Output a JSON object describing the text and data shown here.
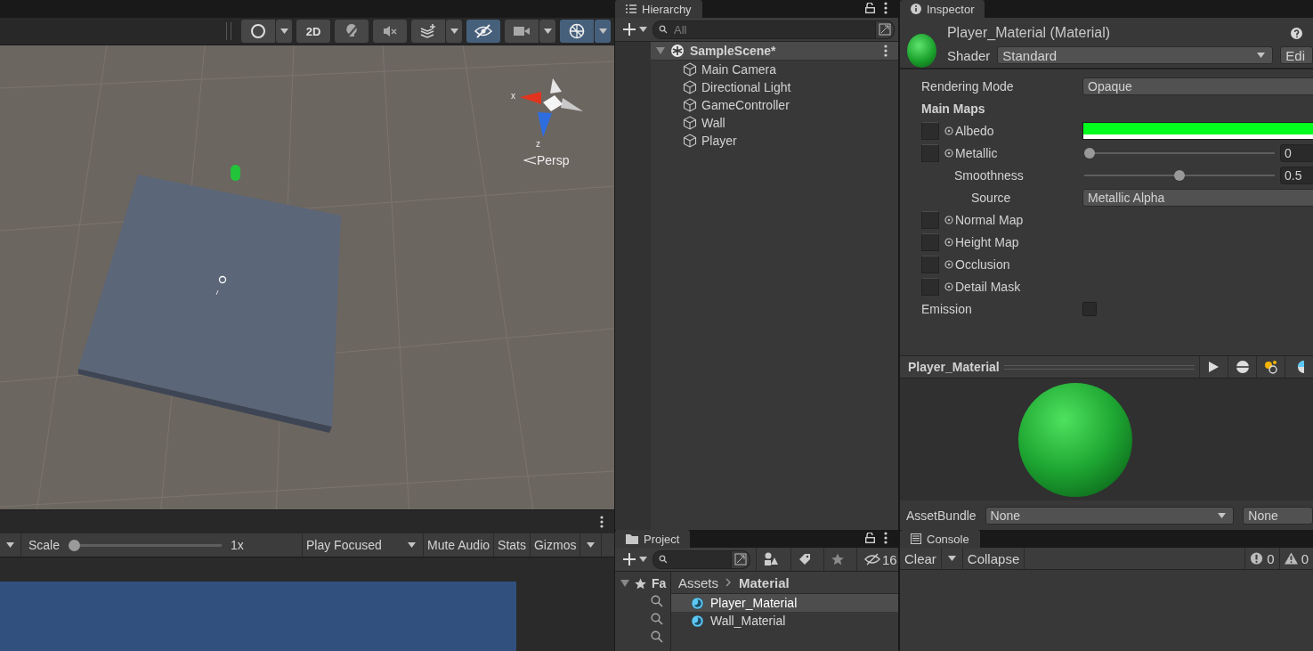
{
  "scene_view": {
    "toolbar": [
      {
        "kind": "shading",
        "selected": false,
        "dropdown": true
      },
      {
        "kind": "mode_2d",
        "label": "2D",
        "selected": false,
        "dropdown": false
      },
      {
        "kind": "lighting",
        "selected": false,
        "dropdown": false
      },
      {
        "kind": "audio",
        "selected": false,
        "dropdown": false
      },
      {
        "kind": "effects",
        "selected": false,
        "dropdown": true
      },
      {
        "kind": "visibility",
        "selected": true,
        "dropdown": false
      },
      {
        "kind": "camera",
        "selected": false,
        "dropdown": true
      },
      {
        "kind": "gizmos",
        "selected": true,
        "dropdown": true
      }
    ],
    "axis_labels": [
      "x",
      "z"
    ],
    "projection": "Persp"
  },
  "game_view": {
    "scale_label": "Scale",
    "scale": {
      "level": 0
    },
    "scale_reading": "1x",
    "play_mode": "Play Focused",
    "toggles": [
      {
        "label": "Mute Audio",
        "selected": false,
        "dropdown": false
      },
      {
        "label": "Stats",
        "selected": false,
        "dropdown": false
      },
      {
        "label": "Gizmos",
        "selected": false,
        "dropdown": true
      }
    ]
  },
  "hierarchy": {
    "tab": "Hierarchy",
    "search": {
      "placeholder": "All"
    },
    "scene": {
      "name": "SampleScene*",
      "expanded": true,
      "children": [
        {
          "name": "Main Camera"
        },
        {
          "name": "Directional Light"
        },
        {
          "name": "GameController"
        },
        {
          "name": "Wall"
        },
        {
          "name": "Player"
        }
      ]
    }
  },
  "project": {
    "tab": "Project",
    "hidden_count": "16",
    "favorites": {
      "label": "Fa",
      "expanded": true,
      "saved_searches": [
        {
          "kind": "search"
        },
        {
          "kind": "search"
        },
        {
          "kind": "search"
        }
      ]
    },
    "breadcrumb": [
      "Assets",
      "Material"
    ],
    "files": [
      {
        "name": "Player_Material",
        "selected": true
      },
      {
        "name": "Wall_Material",
        "selected": false
      }
    ]
  },
  "inspector": {
    "tab": "Inspector",
    "title": "Player_Material (Material)",
    "shader_label": "Shader",
    "shader": "Standard",
    "edit_button": "Edi",
    "properties": [
      {
        "kind": "dropdown",
        "label": "Rendering Mode",
        "value": "Opaque"
      },
      {
        "kind": "header",
        "label": "Main Maps"
      },
      {
        "kind": "color_texture",
        "label": "Albedo",
        "color": "#00ff1e"
      },
      {
        "kind": "slider_texture",
        "label": "Metallic",
        "level": 0,
        "value": "0",
        "children": [
          {
            "kind": "slider",
            "label": "Smoothness",
            "level": 0.5,
            "value": "0.5",
            "children": [
              {
                "kind": "dropdown",
                "label": "Source",
                "value": "Metallic Alpha"
              }
            ]
          }
        ]
      },
      {
        "kind": "texture",
        "label": "Normal Map"
      },
      {
        "kind": "texture",
        "label": "Height Map"
      },
      {
        "kind": "texture",
        "label": "Occlusion"
      },
      {
        "kind": "texture",
        "label": "Detail Mask"
      },
      {
        "kind": "toggle",
        "label": "Emission",
        "checked": false
      }
    ],
    "preview": {
      "title": "Player_Material"
    },
    "asset_bundle": {
      "label": "AssetBundle",
      "name": "None",
      "variant": "None"
    }
  },
  "console": {
    "tab": "Console",
    "clear": "Clear",
    "collapse": "Collapse",
    "error_count": "0",
    "warning_count": "0"
  }
}
